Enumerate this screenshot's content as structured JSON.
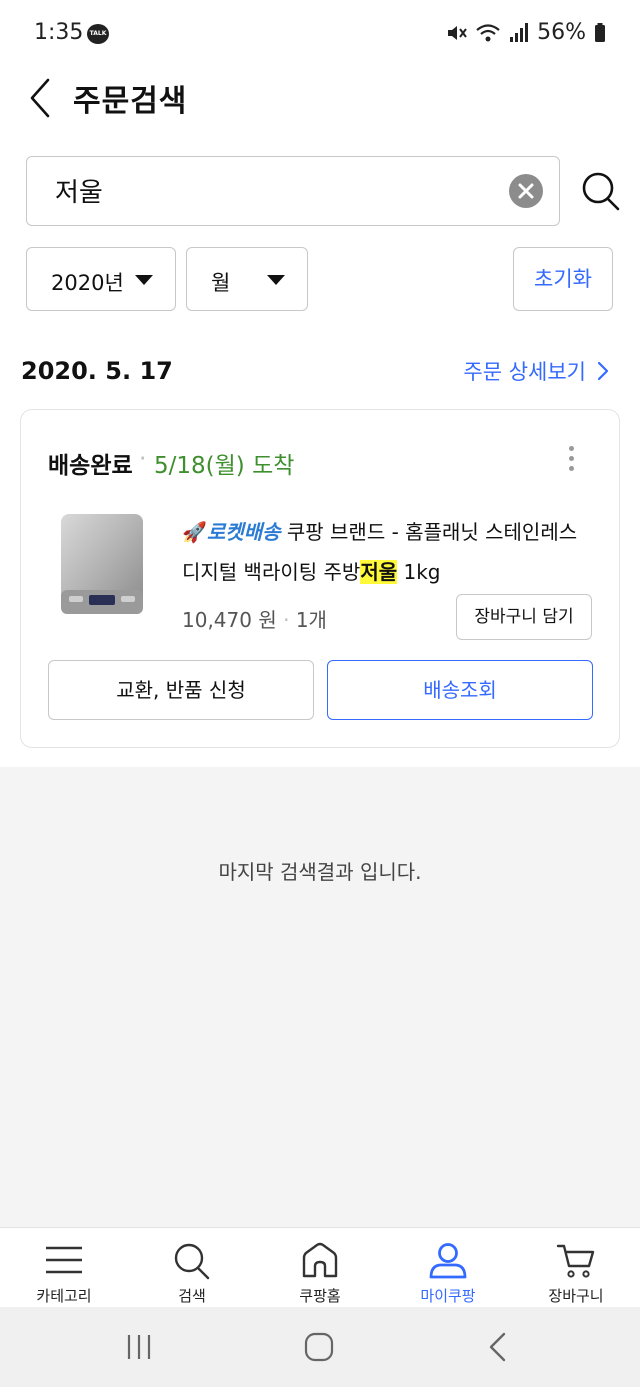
{
  "status_bar": {
    "time": "1:35",
    "notification_icon": "kakaotalk-icon",
    "notification_text": "TALK",
    "battery": "56%"
  },
  "header": {
    "title": "주문검색"
  },
  "search": {
    "value": "저울"
  },
  "filters": {
    "year": "2020년",
    "month": "월",
    "reset": "초기화"
  },
  "order": {
    "date": "2020. 5. 17",
    "detail_link": "주문 상세보기",
    "status": "배송완료",
    "status_separator": "·",
    "arrival": "5/18(월) 도착",
    "product": {
      "rocket_label": "로켓배송",
      "name_part1": "쿠팡 브랜드 - 홈플래닛 스테인레스",
      "name_part2_pre": "디지털 백라이팅 주방",
      "name_highlight": "저울",
      "name_part2_post": " 1kg",
      "price": "10,470 원",
      "quantity_separator": "·",
      "quantity": "1개",
      "cart_button": "장바구니 담기"
    },
    "return_button": "교환, 반품 신청",
    "track_button": "배송조회"
  },
  "end_message": "마지막 검색결과 입니다.",
  "bottom_nav": [
    {
      "label": "카테고리",
      "icon": "menu-icon",
      "active": false
    },
    {
      "label": "검색",
      "icon": "search-icon",
      "active": false
    },
    {
      "label": "쿠팡홈",
      "icon": "home-icon",
      "active": false
    },
    {
      "label": "마이쿠팡",
      "icon": "user-icon",
      "active": true
    },
    {
      "label": "장바구니",
      "icon": "cart-icon",
      "active": false
    }
  ],
  "colors": {
    "accent": "#346aff",
    "delivered_green": "#3f8f2f",
    "highlight": "#fff93a"
  }
}
